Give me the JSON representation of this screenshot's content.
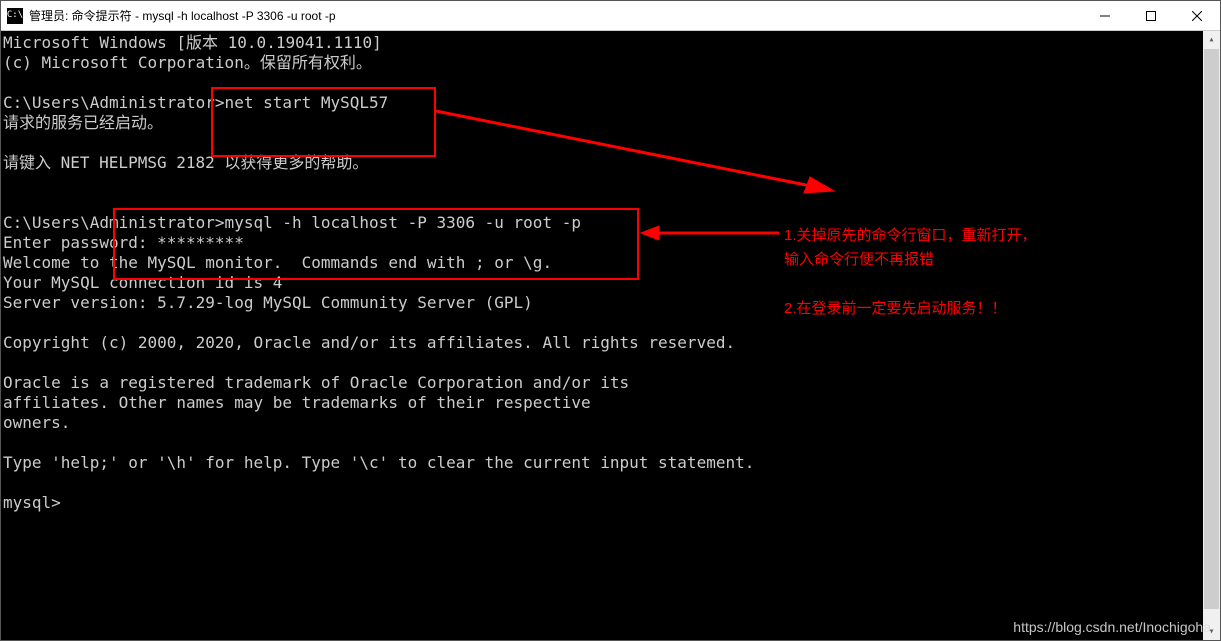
{
  "titlebar": {
    "icon_text": "C:\\",
    "title": "管理员: 命令提示符 - mysql  -h localhost -P 3306 -u root -p"
  },
  "terminal": {
    "lines": [
      "Microsoft Windows [版本 10.0.19041.1110]",
      "(c) Microsoft Corporation。保留所有权利。",
      "",
      "C:\\Users\\Administrator>net start MySQL57",
      "请求的服务已经启动。",
      "",
      "请键入 NET HELPMSG 2182 以获得更多的帮助。",
      "",
      "",
      "C:\\Users\\Administrator>mysql -h localhost -P 3306 -u root -p",
      "Enter password: *********",
      "Welcome to the MySQL monitor.  Commands end with ; or \\g.",
      "Your MySQL connection id is 4",
      "Server version: 5.7.29-log MySQL Community Server (GPL)",
      "",
      "Copyright (c) 2000, 2020, Oracle and/or its affiliates. All rights reserved.",
      "",
      "Oracle is a registered trademark of Oracle Corporation and/or its",
      "affiliates. Other names may be trademarks of their respective",
      "owners.",
      "",
      "Type 'help;' or '\\h' for help. Type '\\c' to clear the current input statement.",
      "",
      "mysql>"
    ]
  },
  "annotations": {
    "note1_line1": "1.关掉原先的命令行窗口，重新打开，",
    "note1_line2": "输入命令行便不再报错",
    "note2": "2.在登录前一定要先启动服务！！"
  },
  "watermark": "https://blog.csdn.net/Inochigoha"
}
